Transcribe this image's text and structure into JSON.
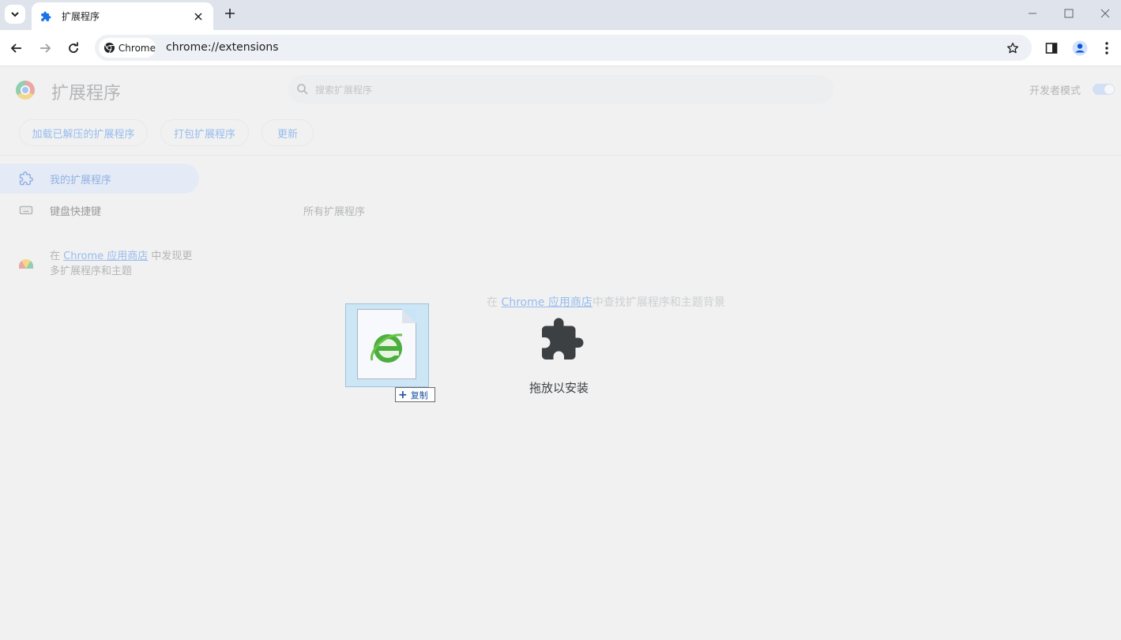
{
  "browser": {
    "tab": {
      "title": "扩展程序",
      "icon": "puzzle-icon"
    },
    "omnibox": {
      "chip_label": "Chrome",
      "url": "chrome://extensions"
    }
  },
  "extensions_page": {
    "title": "扩展程序",
    "search_placeholder": "搜索扩展程序",
    "developer_mode_label": "开发者模式",
    "actions": {
      "load_unpacked": "加载已解压的扩展程序",
      "pack": "打包扩展程序",
      "update": "更新"
    },
    "sidebar": {
      "my_extensions": "我的扩展程序",
      "shortcuts": "键盘快捷键",
      "promo_prefix": "在 ",
      "promo_link": "Chrome 应用商店",
      "promo_suffix": " 中发现更多扩展程序和主题"
    },
    "section_title": "所有扩展程序",
    "store_prefix": "在 ",
    "store_link": "Chrome 应用商店",
    "store_suffix": "中查找扩展程序和主题背景"
  },
  "drop_overlay": {
    "label": "拖放以安装",
    "icon": "puzzle-icon"
  },
  "drag_feedback": {
    "file_icon": "ie-icon",
    "badge_label": "复制"
  },
  "colors": {
    "accent": "#1a73e8",
    "tabstrip": "#dfe3eb",
    "page_bg": "#f1f1f1"
  }
}
